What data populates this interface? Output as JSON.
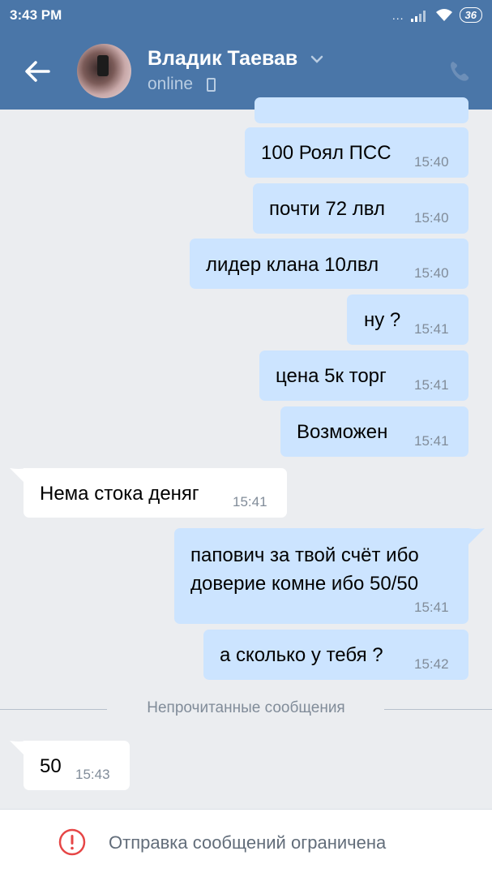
{
  "status_bar": {
    "time": "3:43 PM",
    "signal_dots": "...",
    "battery": "36"
  },
  "header": {
    "contact_name": "Владик Таевав",
    "status": "online"
  },
  "messages": [
    {
      "text": "100 Роял ПСС",
      "time": "15:40",
      "direction": "out"
    },
    {
      "text": "почти 72 лвл",
      "time": "15:40",
      "direction": "out"
    },
    {
      "text": "лидер клана 10лвл",
      "time": "15:40",
      "direction": "out"
    },
    {
      "text": "ну ?",
      "time": "15:41",
      "direction": "out"
    },
    {
      "text": "цена 5к торг",
      "time": "15:41",
      "direction": "out"
    },
    {
      "text": "Возможен",
      "time": "15:41",
      "direction": "out"
    },
    {
      "text": "Нема стока деняг",
      "time": "15:41",
      "direction": "in"
    },
    {
      "text_line1": "папович за твой счёт ибо",
      "text_line2": "доверие комне ибо 50/50",
      "time": "15:41",
      "direction": "out"
    },
    {
      "text": "а сколько у тебя ?",
      "time": "15:42",
      "direction": "out"
    },
    {
      "text": "50",
      "time": "15:43",
      "direction": "in"
    }
  ],
  "unread_divider": "Непрочитанные сообщения",
  "bottom_bar": {
    "notice": "Отправка сообщений ограничена"
  },
  "colors": {
    "header": "#4a76a8",
    "outgoing_bubble": "#cce4ff",
    "incoming_bubble": "#ffffff",
    "background": "#ebedf0",
    "warning": "#e64646"
  }
}
